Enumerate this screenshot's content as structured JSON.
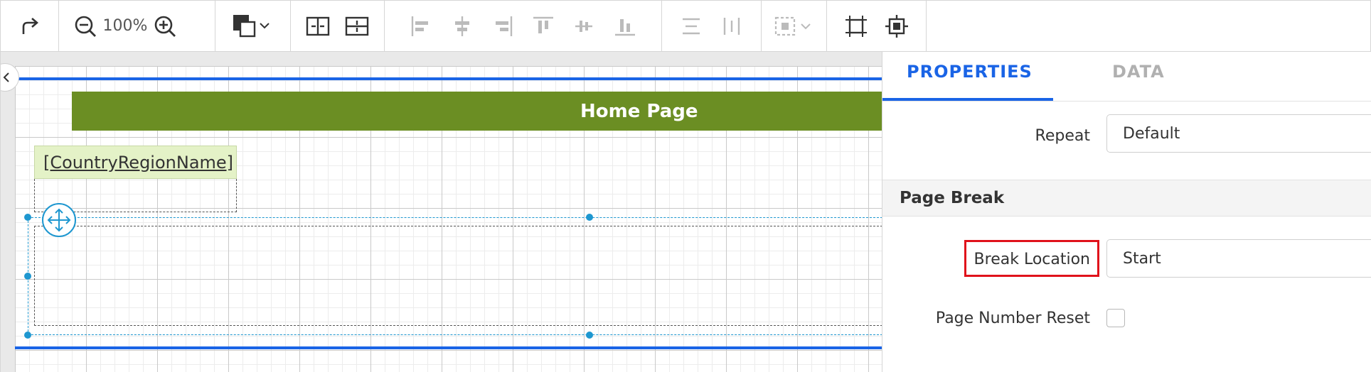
{
  "toolbar": {
    "redo_icon": "redo-arrow-icon",
    "zoom_out_icon": "zoom-out-icon",
    "zoom_level": "100%",
    "zoom_in_icon": "zoom-in-icon",
    "fill_color_icon": "fill-color-icon",
    "accent_color": "#1a64e6"
  },
  "canvas": {
    "header_title": "Home Page",
    "header_color": "#6b8e23",
    "field_placeholder": "[CountryRegionName]",
    "field_color": "#e4f2c7"
  },
  "panel": {
    "tabs": [
      {
        "label": "PROPERTIES",
        "active": true
      },
      {
        "label": "DATA",
        "active": false
      }
    ],
    "repeat": {
      "label": "Repeat",
      "value": "Default"
    },
    "section": {
      "title": "Page Break"
    },
    "break_location": {
      "label": "Break Location",
      "value": "Start",
      "highlight_color": "#e0121b"
    },
    "page_number_reset": {
      "label": "Page Number Reset",
      "checked": false
    }
  }
}
